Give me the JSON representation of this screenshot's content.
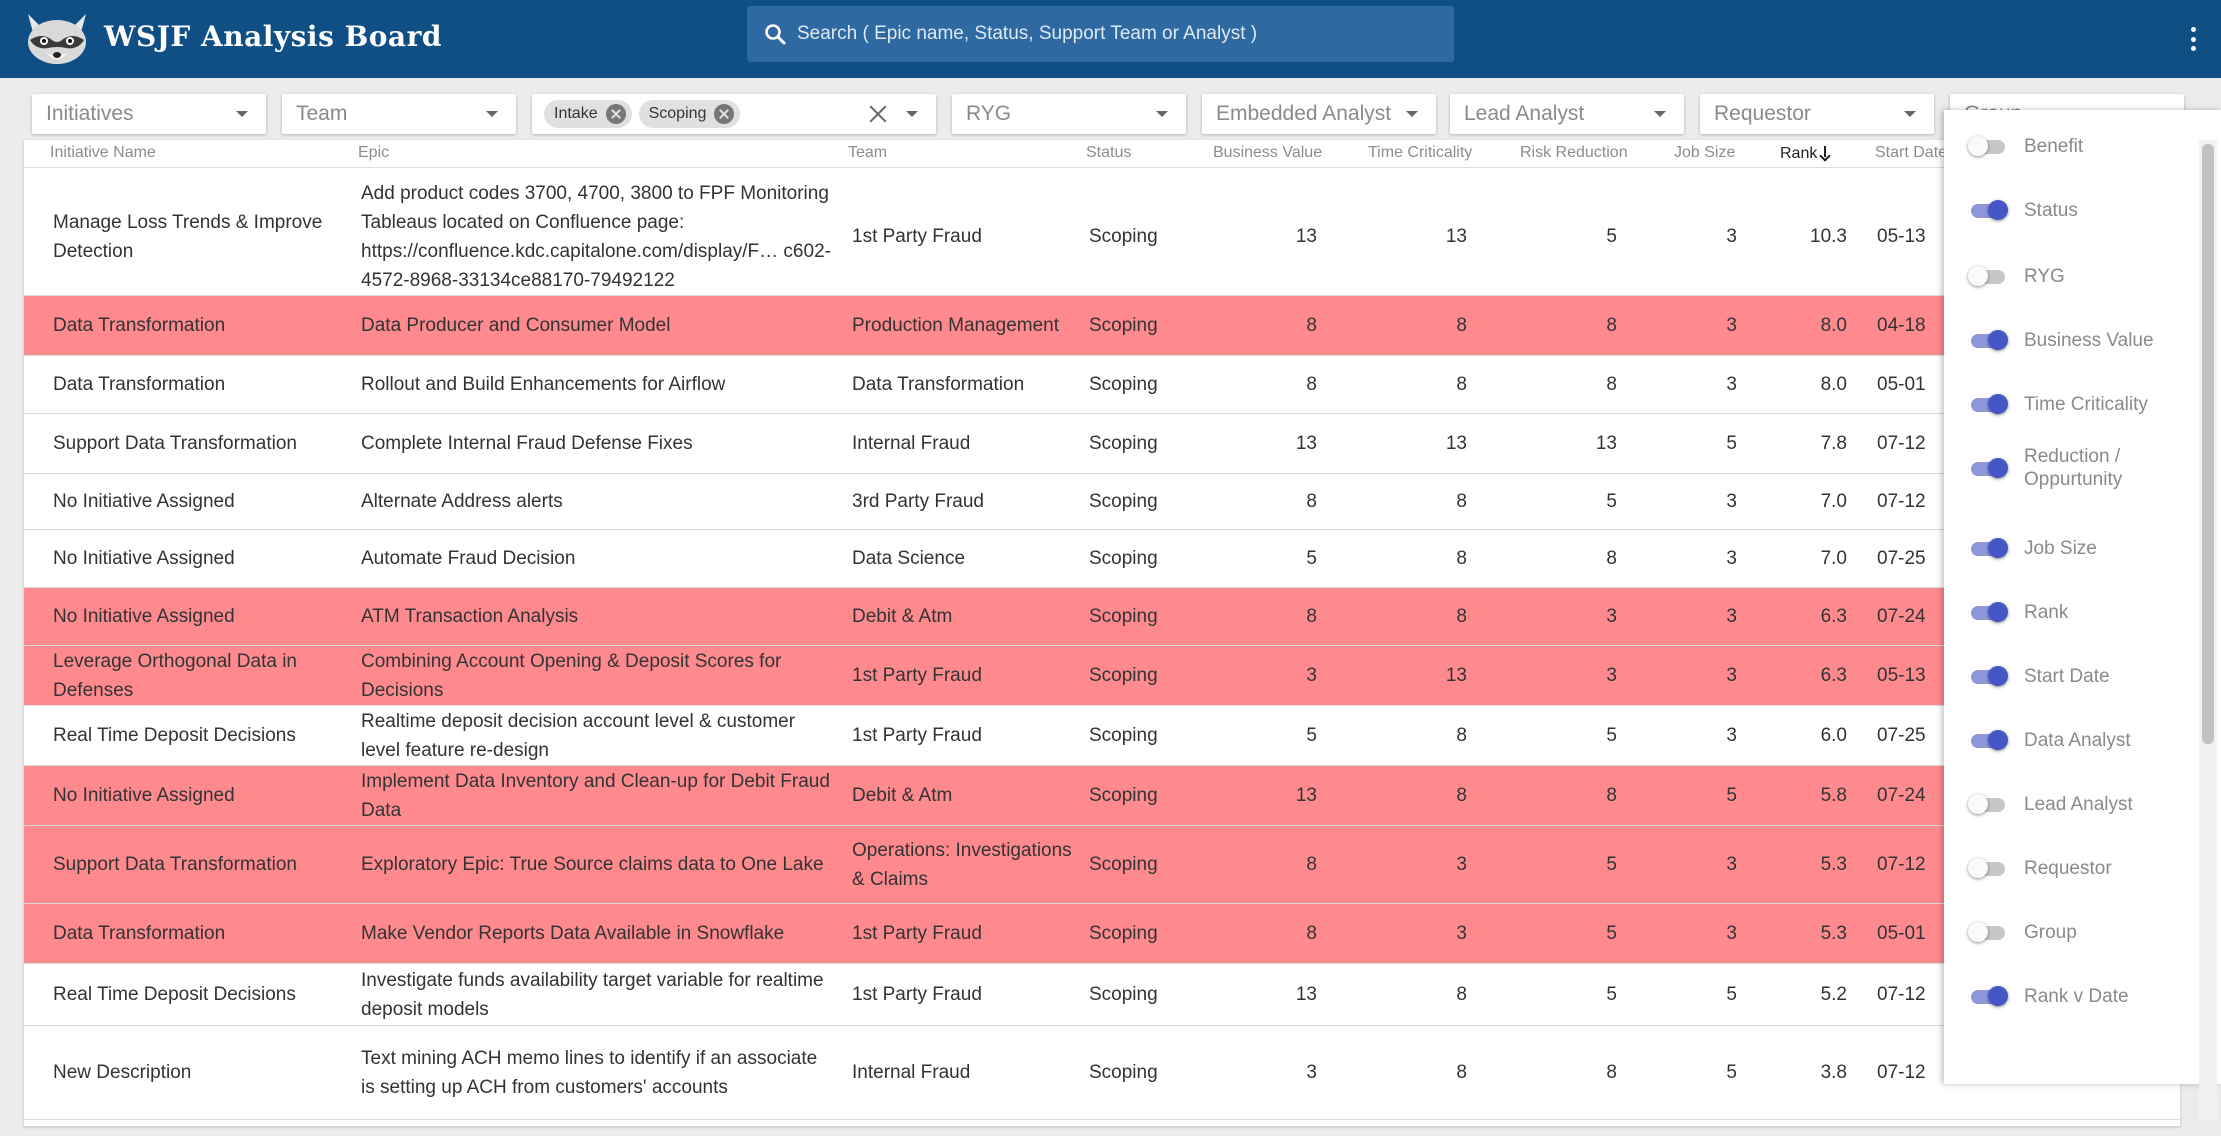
{
  "app": {
    "title": "WSJF Analysis Board",
    "search_placeholder": "Search ( Epic name, Status, Support Team or Analyst )"
  },
  "colors": {
    "appbar": "#0f4f86",
    "search_bg": "#2e6aa1",
    "highlight_row": "#ff8a8e",
    "toggle_on": "#4655c8"
  },
  "filters": {
    "initiatives": "Initiatives",
    "team": "Team",
    "status_chips": [
      "Intake",
      "Scoping"
    ],
    "ryg": "RYG",
    "embedded_analyst": "Embedded Analyst",
    "lead_analyst": "Lead Analyst",
    "requestor": "Requestor",
    "group": "Group"
  },
  "columns": {
    "initiative": "Initiative Name",
    "epic": "Epic",
    "team": "Team",
    "status": "Status",
    "business_value": "Business Value",
    "time_criticality": "Time Criticality",
    "risk_reduction": "Risk Reduction",
    "job_size": "Job Size",
    "rank": "Rank",
    "start_date": "Start Date"
  },
  "rows": [
    {
      "initiative": "Manage Loss Trends & Improve Detection",
      "epic": "Add product codes 3700, 4700, 3800 to FPF Monitoring Tableaus located on Confluence page: https://confluence.kdc.capitalone.com/display/F… c602-4572-8968-33134ce88170-79492122",
      "team": "1st Party Fraud",
      "status": "Scoping",
      "bv": "13",
      "tc": "13",
      "rr": "5",
      "js": "3",
      "rank": "10.3",
      "start": "05-13",
      "highlight": false
    },
    {
      "initiative": "Data Transformation",
      "epic": "Data Producer and Consumer Model",
      "team": "Production Management",
      "status": "Scoping",
      "bv": "8",
      "tc": "8",
      "rr": "8",
      "js": "3",
      "rank": "8.0",
      "start": "04-18",
      "highlight": true
    },
    {
      "initiative": "Data Transformation",
      "epic": "Rollout and Build Enhancements for Airflow",
      "team": "Data Transformation",
      "status": "Scoping",
      "bv": "8",
      "tc": "8",
      "rr": "8",
      "js": "3",
      "rank": "8.0",
      "start": "05-01",
      "highlight": false
    },
    {
      "initiative": "Support Data Transformation",
      "epic": "Complete Internal Fraud Defense Fixes",
      "team": "Internal Fraud",
      "status": "Scoping",
      "bv": "13",
      "tc": "13",
      "rr": "13",
      "js": "5",
      "rank": "7.8",
      "start": "07-12",
      "highlight": false
    },
    {
      "initiative": "No Initiative Assigned",
      "epic": "Alternate Address alerts",
      "team": "3rd Party Fraud",
      "status": "Scoping",
      "bv": "8",
      "tc": "8",
      "rr": "5",
      "js": "3",
      "rank": "7.0",
      "start": "07-12",
      "highlight": false
    },
    {
      "initiative": "No Initiative Assigned",
      "epic": "Automate Fraud Decision",
      "team": "Data Science",
      "status": "Scoping",
      "bv": "5",
      "tc": "8",
      "rr": "8",
      "js": "3",
      "rank": "7.0",
      "start": "07-25",
      "highlight": false
    },
    {
      "initiative": "No Initiative Assigned",
      "epic": "ATM Transaction Analysis",
      "team": "Debit & Atm",
      "status": "Scoping",
      "bv": "8",
      "tc": "8",
      "rr": "3",
      "js": "3",
      "rank": "6.3",
      "start": "07-24",
      "highlight": true
    },
    {
      "initiative": "Leverage Orthogonal Data in Defenses",
      "epic": "Combining Account Opening & Deposit Scores for Decisions",
      "team": "1st Party Fraud",
      "status": "Scoping",
      "bv": "3",
      "tc": "13",
      "rr": "3",
      "js": "3",
      "rank": "6.3",
      "start": "05-13",
      "highlight": true
    },
    {
      "initiative": "Real Time Deposit Decisions",
      "epic": "Realtime deposit decision account level & customer level feature re-design",
      "team": "1st Party Fraud",
      "status": "Scoping",
      "bv": "5",
      "tc": "8",
      "rr": "5",
      "js": "3",
      "rank": "6.0",
      "start": "07-25",
      "highlight": false
    },
    {
      "initiative": "No Initiative Assigned",
      "epic": "Implement Data Inventory and Clean-up for Debit Fraud Data",
      "team": "Debit & Atm",
      "status": "Scoping",
      "bv": "13",
      "tc": "8",
      "rr": "8",
      "js": "5",
      "rank": "5.8",
      "start": "07-24",
      "highlight": true
    },
    {
      "initiative": "Support Data Transformation",
      "epic": "Exploratory Epic: True Source claims data to One Lake",
      "team": "Operations: Investigations & Claims",
      "status": "Scoping",
      "bv": "8",
      "tc": "3",
      "rr": "5",
      "js": "3",
      "rank": "5.3",
      "start": "07-12",
      "highlight": true
    },
    {
      "initiative": "Data Transformation",
      "epic": "Make Vendor Reports Data Available in Snowflake",
      "team": "1st Party Fraud",
      "status": "Scoping",
      "bv": "8",
      "tc": "3",
      "rr": "5",
      "js": "3",
      "rank": "5.3",
      "start": "05-01",
      "highlight": true
    },
    {
      "initiative": "Real Time Deposit Decisions",
      "epic": "Investigate funds availability target variable for realtime deposit models",
      "team": "1st Party Fraud",
      "status": "Scoping",
      "bv": "13",
      "tc": "8",
      "rr": "5",
      "js": "5",
      "rank": "5.2",
      "start": "07-12",
      "highlight": false
    },
    {
      "initiative": "New Description",
      "epic": "Text mining ACH memo lines to identify if an associate is setting up ACH from customers' accounts",
      "team": "Internal Fraud",
      "status": "Scoping",
      "bv": "3",
      "tc": "8",
      "rr": "8",
      "js": "5",
      "rank": "3.8",
      "start": "07-12",
      "highlight": false
    }
  ],
  "column_toggles": [
    {
      "label": "Benefit",
      "on": false
    },
    {
      "label": "Status",
      "on": true
    },
    {
      "label": "RYG",
      "on": false
    },
    {
      "label": "Business Value",
      "on": true
    },
    {
      "label": "Time Criticality",
      "on": true
    },
    {
      "label": "Reduction / Oppurtunity",
      "on": true
    },
    {
      "label": "Job Size",
      "on": true
    },
    {
      "label": "Rank",
      "on": true
    },
    {
      "label": "Start Date",
      "on": true
    },
    {
      "label": "Data Analyst",
      "on": true
    },
    {
      "label": "Lead Analyst",
      "on": false
    },
    {
      "label": "Requestor",
      "on": false
    },
    {
      "label": "Group",
      "on": false
    },
    {
      "label": "Rank v Date",
      "on": true
    }
  ]
}
